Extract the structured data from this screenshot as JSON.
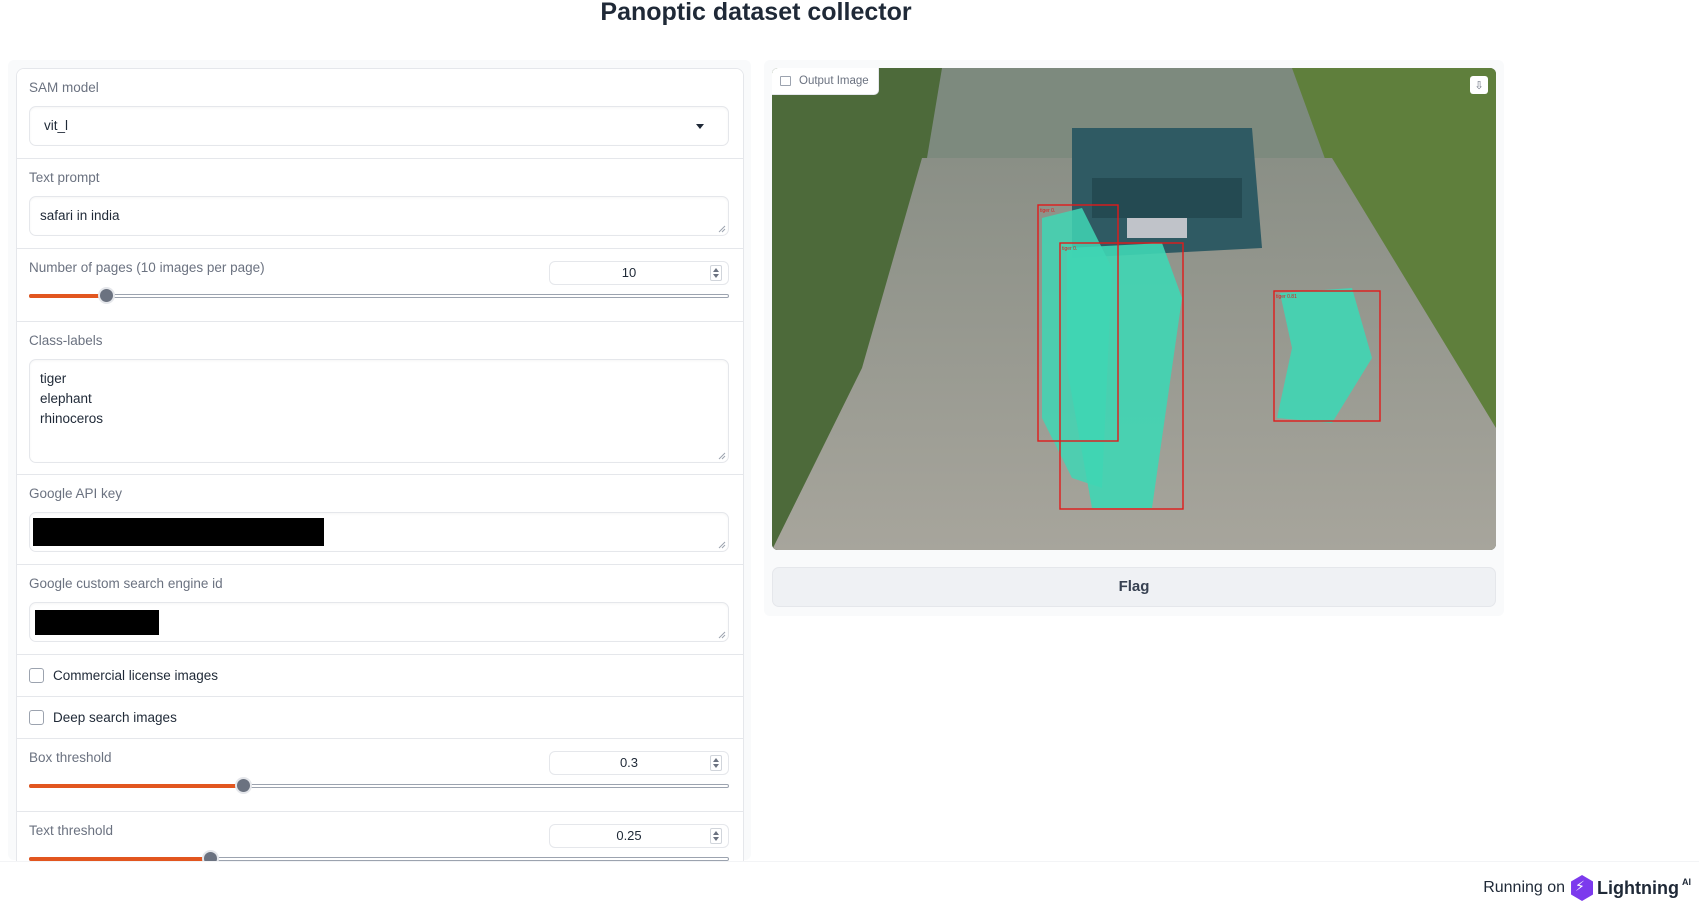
{
  "title": "Panoptic dataset collector",
  "inputs": {
    "sam_model": {
      "label": "SAM model",
      "value": "vit_l"
    },
    "text_prompt": {
      "label": "Text prompt",
      "value": "safari in india"
    },
    "num_pages": {
      "label": "Number of pages (10 images per page)",
      "value": "10",
      "fraction": 0.11
    },
    "class_labels": {
      "label": "Class-labels",
      "lines": [
        "tiger",
        "elephant",
        "rhinoceros"
      ]
    },
    "google_api_key": {
      "label": "Google API key"
    },
    "search_engine_id": {
      "label": "Google custom search engine id"
    },
    "commercial_license": {
      "label": "Commercial license images",
      "checked": false
    },
    "deep_search": {
      "label": "Deep search images",
      "checked": false
    },
    "box_threshold": {
      "label": "Box threshold",
      "value": "0.3",
      "fraction": 0.306
    },
    "text_threshold": {
      "label": "Text threshold",
      "value": "0.25",
      "fraction": 0.258
    }
  },
  "output": {
    "label": "Output Image",
    "detections": [
      "tiger 0.",
      "tiger 0.",
      "tiger 0.81"
    ],
    "download_icon": "download-icon"
  },
  "flag_button": "Flag",
  "footer": {
    "prefix": "Running on",
    "brand": "Lightning",
    "suffix": "AI"
  },
  "colors": {
    "accent": "#e2561f",
    "mask": "#3fd6b4",
    "box": "#e01b1b",
    "logo": "#7c3aed"
  }
}
